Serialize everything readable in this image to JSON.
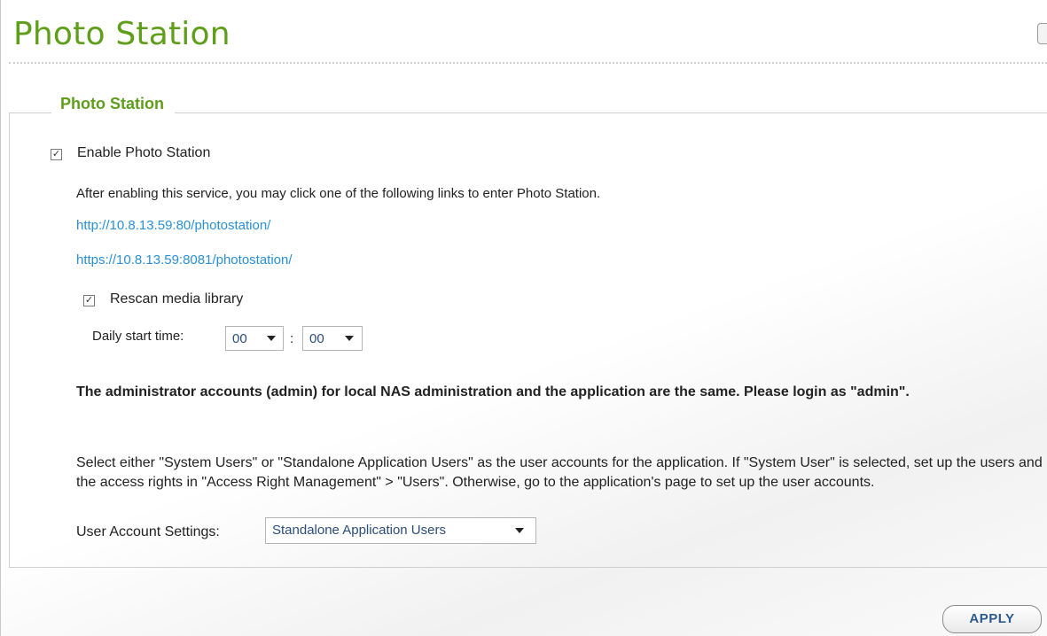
{
  "page": {
    "title": "Photo Station"
  },
  "section": {
    "legend": "Photo Station"
  },
  "enable": {
    "label": "Enable Photo Station",
    "checked": true,
    "description": "After enabling this service, you may click one of the following links to enter Photo Station.",
    "links": [
      "http://10.8.13.59:80/photostation/",
      "https://10.8.13.59:8081/photostation/"
    ]
  },
  "rescan": {
    "label": "Rescan media library",
    "checked": true,
    "start_time_label": "Daily start time:",
    "hour": "00",
    "separator": ":",
    "minute": "00"
  },
  "accounts": {
    "admin_note": "The administrator accounts (admin) for local NAS administration and the application are the same. Please login as \"admin\".",
    "description": "Select either \"System Users\" or \"Standalone Application Users\" as the user accounts for the application. If \"System User\" is selected, set up the users and the access rights in \"Access Right Management\" > \"Users\". Otherwise, go to the application's page to set up the user accounts.",
    "settings_label": "User Account Settings:",
    "settings_value": "Standalone Application Users"
  },
  "actions": {
    "apply_label": "APPLY"
  },
  "colors": {
    "title_green": "#5e9e1a",
    "link_blue": "#2a8fd4",
    "button_text": "#2c5a8c"
  }
}
